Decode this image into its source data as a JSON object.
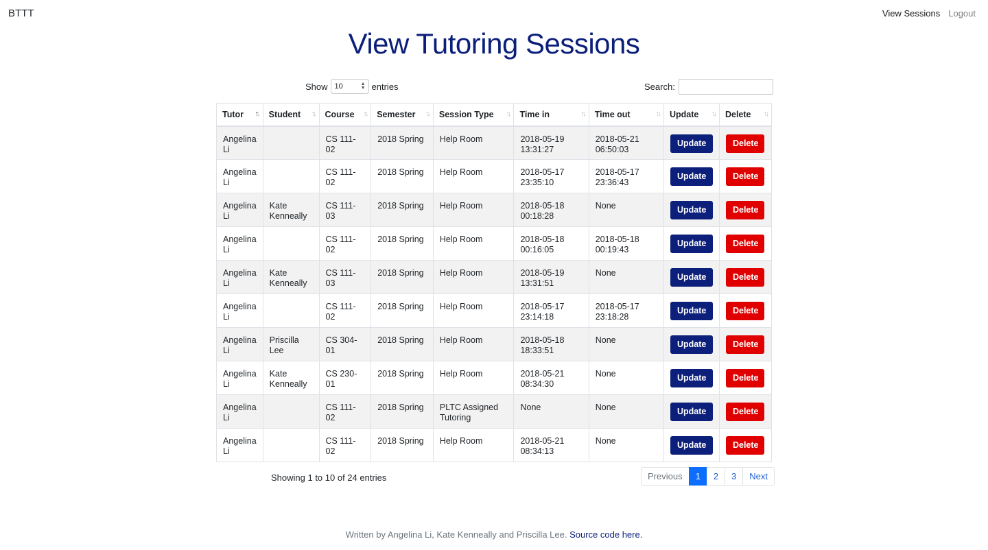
{
  "nav": {
    "brand": "BTTT",
    "links": [
      "View Sessions",
      "Logout"
    ]
  },
  "title": "View Tutoring Sessions",
  "controls": {
    "show_label": "Show",
    "entries_value": "10",
    "entries_label": "entries",
    "search_label": "Search:",
    "search_value": ""
  },
  "table": {
    "columns": [
      "Tutor",
      "Student",
      "Course",
      "Semester",
      "Session Type",
      "Time in",
      "Time out",
      "Update",
      "Delete"
    ],
    "sorted_column": "Tutor",
    "sort_direction": "ascending",
    "rows": [
      {
        "tutor": "Angelina Li",
        "student": "",
        "course": "CS 111-02",
        "semester": "2018 Spring",
        "session_type": "Help Room",
        "time_in": "2018-05-19 13:31:27",
        "time_out": "2018-05-21 06:50:03",
        "update": "Update",
        "delete": "Delete"
      },
      {
        "tutor": "Angelina Li",
        "student": "",
        "course": "CS 111-02",
        "semester": "2018 Spring",
        "session_type": "Help Room",
        "time_in": "2018-05-17 23:35:10",
        "time_out": "2018-05-17 23:36:43",
        "update": "Update",
        "delete": "Delete"
      },
      {
        "tutor": "Angelina Li",
        "student": "Kate Kenneally",
        "course": "CS 111-03",
        "semester": "2018 Spring",
        "session_type": "Help Room",
        "time_in": "2018-05-18 00:18:28",
        "time_out": "None",
        "update": "Update",
        "delete": "Delete"
      },
      {
        "tutor": "Angelina Li",
        "student": "",
        "course": "CS 111-02",
        "semester": "2018 Spring",
        "session_type": "Help Room",
        "time_in": "2018-05-18 00:16:05",
        "time_out": "2018-05-18 00:19:43",
        "update": "Update",
        "delete": "Delete"
      },
      {
        "tutor": "Angelina Li",
        "student": "Kate Kenneally",
        "course": "CS 111-03",
        "semester": "2018 Spring",
        "session_type": "Help Room",
        "time_in": "2018-05-19 13:31:51",
        "time_out": "None",
        "update": "Update",
        "delete": "Delete"
      },
      {
        "tutor": "Angelina Li",
        "student": "",
        "course": "CS 111-02",
        "semester": "2018 Spring",
        "session_type": "Help Room",
        "time_in": "2018-05-17 23:14:18",
        "time_out": "2018-05-17 23:18:28",
        "update": "Update",
        "delete": "Delete"
      },
      {
        "tutor": "Angelina Li",
        "student": "Priscilla Lee",
        "course": "CS 304-01",
        "semester": "2018 Spring",
        "session_type": "Help Room",
        "time_in": "2018-05-18 18:33:51",
        "time_out": "None",
        "update": "Update",
        "delete": "Delete"
      },
      {
        "tutor": "Angelina Li",
        "student": "Kate Kenneally",
        "course": "CS 230-01",
        "semester": "2018 Spring",
        "session_type": "Help Room",
        "time_in": "2018-05-21 08:34:30",
        "time_out": "None",
        "update": "Update",
        "delete": "Delete"
      },
      {
        "tutor": "Angelina Li",
        "student": "",
        "course": "CS 111-02",
        "semester": "2018 Spring",
        "session_type": "PLTC Assigned Tutoring",
        "time_in": "None",
        "time_out": "None",
        "update": "Update",
        "delete": "Delete"
      },
      {
        "tutor": "Angelina Li",
        "student": "",
        "course": "CS 111-02",
        "semester": "2018 Spring",
        "session_type": "Help Room",
        "time_in": "2018-05-21 08:34:13",
        "time_out": "None",
        "update": "Update",
        "delete": "Delete"
      }
    ]
  },
  "info": "Showing 1 to 10 of 24 entries",
  "pagination": {
    "previous": "Previous",
    "pages": [
      "1",
      "2",
      "3"
    ],
    "active_page": "1",
    "next": "Next"
  },
  "footer": {
    "text": "Written by Angelina Li, Kate Kenneally and Priscilla Lee.",
    "link": "Source code here."
  },
  "colors": {
    "title": "#0b1f7a",
    "update_button": "#0c1f7a",
    "delete_button": "#e00000",
    "active_page": "#0d6efd"
  }
}
